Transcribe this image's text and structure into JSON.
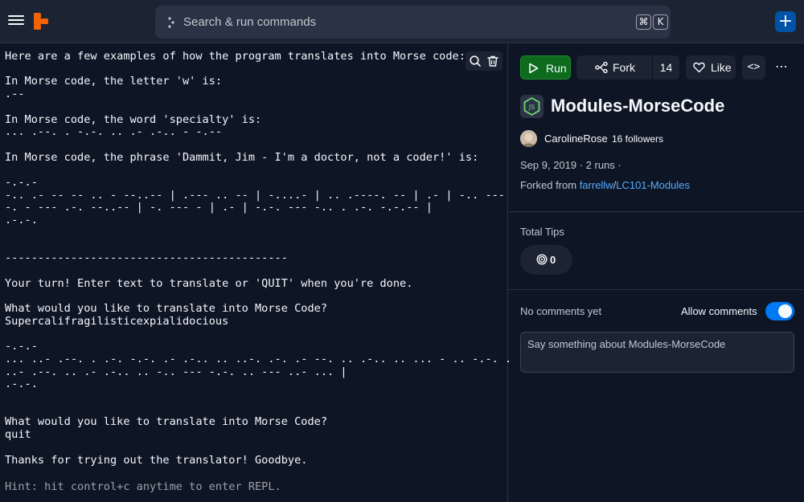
{
  "topbar": {
    "search_placeholder": "Search & run commands",
    "shortcut_cmd": "⌘",
    "shortcut_key": "K",
    "new_label": "+"
  },
  "console": {
    "output": "Here are a few examples of how the program translates into Morse code:\n\nIn Morse code, the letter 'w' is:\n.--\n\nIn Morse code, the word 'specialty' is:\n... .--. . -.-. .. .- .-.. - -.--\n\nIn Morse code, the phrase 'Dammit, Jim - I'm a doctor, not a coder!' is:\n\n-.-.-\n-.. .- -- -- .. - --..-- | .--- .. -- | -....- | .. .----. -- | .- | -.. --- -.\n-. - --- .-. --..-- | -. --- - | .- | -.-. --- -.. . .-. -.-.-- |\n.-.-.\n\n\n-------------------------------------------\n\nYour turn! Enter text to translate or 'QUIT' when you're done.\n\nWhat would you like to translate into Morse Code?\nSupercalifragilisticexpialidocious\n\n-.-.-\n... ..- .--. . .-. -.-. .- .-.. .. ..-. .-. .- --. .. .-.. .. ... - .. -.-. . -\n..- .--. .. .- .-.. .. -.. --- -.-. .. --- ..- ... |\n.-.-.\n\n\nWhat would you like to translate into Morse Code?\nquit\n\nThanks for trying out the translator! Goodbye.",
    "hint": "Hint: hit control+c anytime to enter REPL."
  },
  "panel": {
    "run_label": "Run",
    "fork_label": "Fork",
    "fork_count": "14",
    "like_label": "Like",
    "code_label": "<>",
    "more_label": "⋯",
    "title": "Modules-MorseCode",
    "author": "CarolineRose",
    "followers": "16 followers",
    "meta": "Sep 9, 2019 · 2 runs ·",
    "forked_prefix": "Forked from ",
    "forked_user": "farrellw",
    "forked_sep": "/",
    "forked_repl": "LC101-Modules",
    "tips_label": "Total Tips",
    "tips_count": "0",
    "no_comments": "No comments yet",
    "allow_comments": "Allow comments",
    "comment_placeholder": "Say something about Modules-MorseCode"
  },
  "colors": {
    "accent": "#0079f2",
    "run_green": "#0e6b1e",
    "link": "#57abff",
    "logo_orange": "#f26207"
  },
  "icons": [
    "menu-icon",
    "replit-logo-icon",
    "command-dots-icon",
    "search-icon",
    "trash-icon",
    "play-icon",
    "fork-icon",
    "heart-icon",
    "code-icon",
    "more-icon",
    "nodejs-icon",
    "tip-spiral-icon"
  ]
}
